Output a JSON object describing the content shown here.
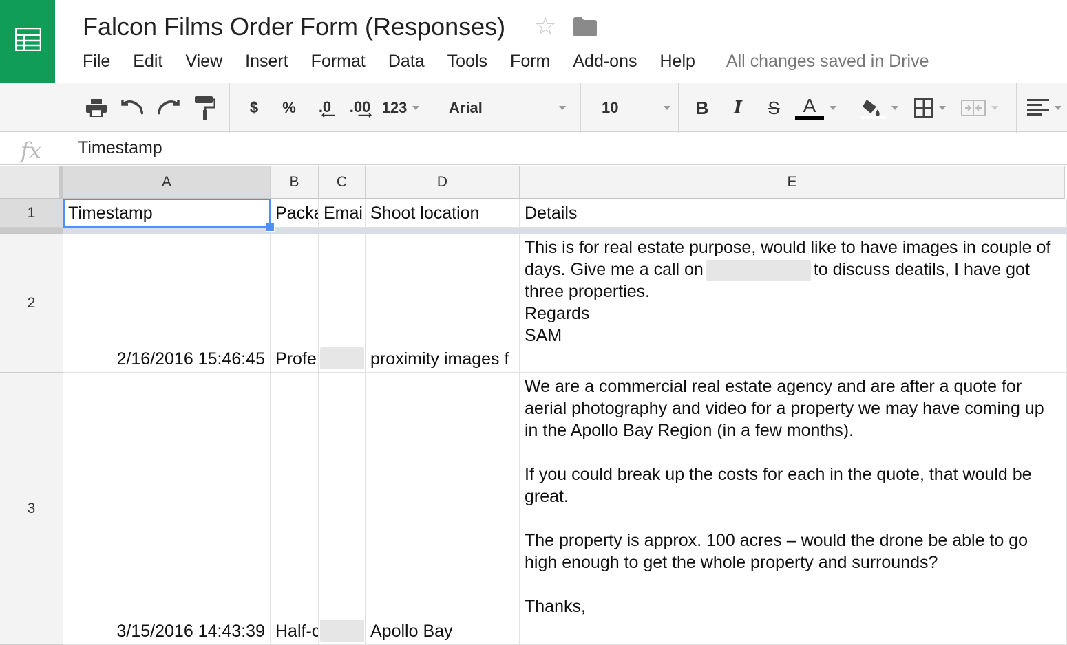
{
  "doc": {
    "title": "Falcon Films Order Form (Responses)",
    "saved_status": "All changes saved in Drive"
  },
  "menu": [
    "File",
    "Edit",
    "View",
    "Insert",
    "Format",
    "Data",
    "Tools",
    "Form",
    "Add-ons",
    "Help"
  ],
  "toolbar": {
    "currency": "$",
    "percent": "%",
    "decrease_decimal": ".0",
    "increase_decimal": ".00",
    "more_formats": "123",
    "font": "Arial",
    "font_size": "10",
    "bold": "B",
    "italic": "I",
    "strikethrough": "S",
    "text_color": "A"
  },
  "formula_bar": {
    "fx": "fx",
    "value": "Timestamp"
  },
  "columns": [
    "A",
    "B",
    "C",
    "D",
    "E"
  ],
  "rows": [
    "1",
    "2",
    "3"
  ],
  "cells": {
    "r1": {
      "a": "Timestamp",
      "b": "Packa",
      "c": "Emai",
      "d": "Shoot location",
      "e": "Details"
    },
    "r2": {
      "a": "2/16/2016 15:46:45",
      "b": "Profe",
      "d": "proximity images  f",
      "e1": "This is for real estate purpose, would like to have images in couple of days. Give me a call on",
      "e2": "to discuss deatils, I have got three properties.",
      "e3": "Regards",
      "e4": "SAM"
    },
    "r3": {
      "a": "3/15/2016 14:43:39",
      "b": "Half-c",
      "d": "Apollo Bay",
      "e1": "We are a commercial real estate agency and are after a quote for aerial photography and video for a property we may have coming up in the Apollo Bay Region (in a few months).",
      "e2": "If you could break up the costs for each in the quote, that would be great.",
      "e3": "The property is approx. 100 acres – would the drone be able to go high enough to get the whole property and surrounds?",
      "e4": "Thanks,"
    }
  },
  "colors": {
    "brand": "#0f9d58",
    "selection": "#4d90fe"
  }
}
